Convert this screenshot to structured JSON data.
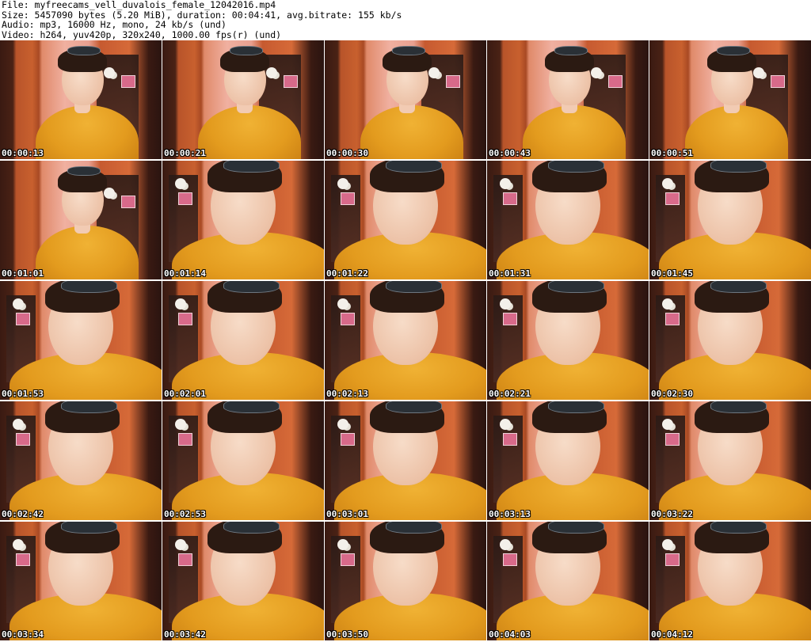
{
  "header": {
    "file": "File: myfreecams_vell_duvalois_female_12042016.mp4",
    "size": "Size: 5457090 bytes (5.20 MiB), duration: 00:04:41, avg.bitrate: 155 kb/s",
    "audio": "Audio: mp3, 16000 Hz, mono, 24 kb/s (und)",
    "video": "Video: h264, yuv420p, 320x240, 1000.00 fps(r) (und)"
  },
  "thumbnails": [
    {
      "timestamp": "00:00:13"
    },
    {
      "timestamp": "00:00:21"
    },
    {
      "timestamp": "00:00:30"
    },
    {
      "timestamp": "00:00:43"
    },
    {
      "timestamp": "00:00:51"
    },
    {
      "timestamp": "00:01:01"
    },
    {
      "timestamp": "00:01:14"
    },
    {
      "timestamp": "00:01:22"
    },
    {
      "timestamp": "00:01:31"
    },
    {
      "timestamp": "00:01:45"
    },
    {
      "timestamp": "00:01:53"
    },
    {
      "timestamp": "00:02:01"
    },
    {
      "timestamp": "00:02:13"
    },
    {
      "timestamp": "00:02:21"
    },
    {
      "timestamp": "00:02:30"
    },
    {
      "timestamp": "00:02:42"
    },
    {
      "timestamp": "00:02:53"
    },
    {
      "timestamp": "00:03:01"
    },
    {
      "timestamp": "00:03:13"
    },
    {
      "timestamp": "00:03:22"
    },
    {
      "timestamp": "00:03:34"
    },
    {
      "timestamp": "00:03:42"
    },
    {
      "timestamp": "00:03:50"
    },
    {
      "timestamp": "00:04:03"
    },
    {
      "timestamp": "00:04:12"
    }
  ]
}
